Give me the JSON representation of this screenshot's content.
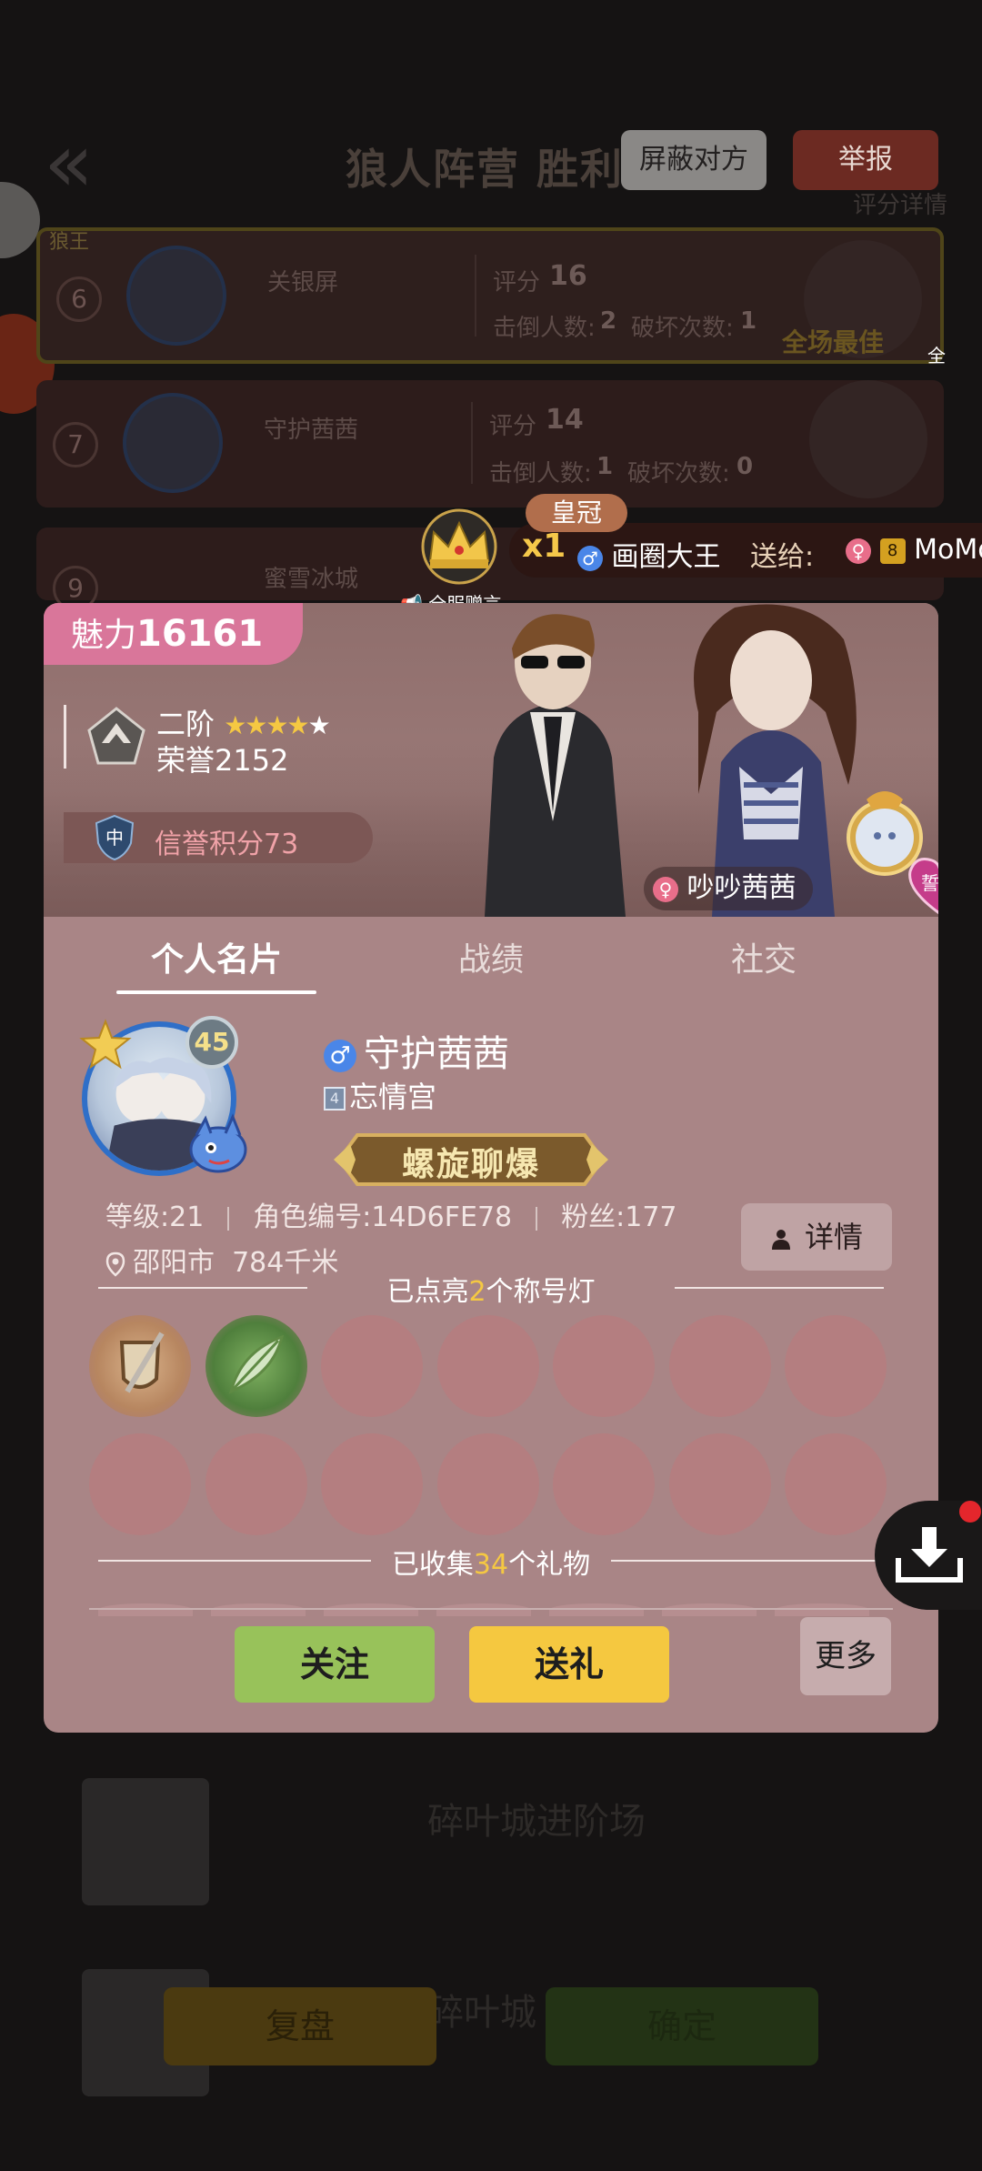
{
  "background": {
    "header_title": "狼人阵营 胜利",
    "block_button": "屏蔽对方",
    "report_button": "举报",
    "score_detail": "评分详情",
    "rows": [
      {
        "rank": "6",
        "name": "关银屏",
        "score_label": "评分",
        "score": "16",
        "kills_label": "击倒人数:",
        "kills": "2",
        "damage_label": "破坏次数:",
        "damage": "1",
        "tag": "狼王",
        "best": "全场最佳"
      },
      {
        "rank": "7",
        "name": "守护茜茜",
        "score_label": "评分",
        "score": "14",
        "kills_label": "击倒人数:",
        "kills": "1",
        "damage_label": "破坏次数:",
        "damage": "0"
      },
      {
        "rank": "9",
        "name": "蜜雪冰城"
      }
    ],
    "bottom_texts": [
      "碎叶城进阶场",
      "碎叶城"
    ],
    "replay_button": "复盘",
    "confirm_button": "确定"
  },
  "gift_banner": {
    "gift_name": "皇冠",
    "count": "x1",
    "from_user": "画圈大王",
    "to_label": "送给:",
    "vip_level": "8",
    "to_user": "MoMo",
    "global_tag": "全服赠言",
    "global_tag_short": "全"
  },
  "profile": {
    "charm_label": "魅力",
    "charm_value": "16161",
    "rank_name": "二阶",
    "honor_label": "荣誉",
    "honor_value": "2152",
    "credit_level": "中",
    "credit_label": "信誉积分",
    "credit_value": "73",
    "couple_name": "吵吵茜茜",
    "pledge_badge": "誓约",
    "tabs": [
      "个人名片",
      "战绩",
      "社交"
    ],
    "active_tab": 0,
    "level_badge": "45",
    "name": "守护茜茜",
    "guild_rank": "4",
    "guild": "忘情宫",
    "title": "螺旋聊爆",
    "stats": {
      "level": "等级:21",
      "role_id": "角色编号:14D6FE78",
      "fans": "粉丝:177"
    },
    "location": "邵阳市",
    "distance": "784千米",
    "detail_button": "详情",
    "lamps_prefix": "已点亮",
    "lamps_count": "2",
    "lamps_suffix": "个称号灯",
    "lamps_total": 14,
    "lamps_lit": 2,
    "gifts_prefix": "已收集",
    "gifts_count": "34",
    "gifts_suffix": "个礼物",
    "follow_button": "关注",
    "gift_button": "送礼",
    "more_button": "更多"
  },
  "colors": {
    "card": "#a98586",
    "charm": "#d9769a",
    "follow": "#98c25a",
    "gift": "#f5c840",
    "highlight": "#f5c842",
    "male": "#4a86e8",
    "female": "#e86e8a"
  }
}
